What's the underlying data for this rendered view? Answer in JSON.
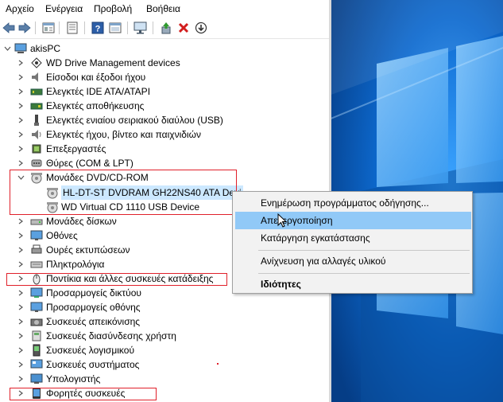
{
  "menu": [
    "Αρχείο",
    "Ενέργεια",
    "Προβολή",
    "Βοήθεια"
  ],
  "tree": {
    "root": "akisPC",
    "categories": [
      "WD Drive Management devices",
      "Είσοδοι και έξοδοι ήχου",
      "Ελεγκτές IDE ATA/ATAPI",
      "Ελεγκτές αποθήκευσης",
      "Ελεγκτές ενιαίου σειριακού διαύλου (USB)",
      "Ελεγκτές ήχου, βίντεο και παιχνιδιών",
      "Επεξεργαστές",
      "Θύρες (COM & LPT)",
      "Μονάδες DVD/CD-ROM",
      "Μονάδες δίσκων",
      "Οθόνες",
      "Ουρές εκτυπώσεων",
      "Πληκτρολόγια",
      "Ποντίκια και άλλες συσκευές κατάδειξης",
      "Προσαρμογείς δικτύου",
      "Προσαρμογείς οθόνης",
      "Συσκευές απεικόνισης",
      "Συσκευές διασύνδεσης χρήστη",
      "Συσκευές λογισμικού",
      "Συσκευές συστήματος",
      "Υπολογιστής",
      "Φορητές συσκευές"
    ],
    "dvd_children": [
      "HL-DT-ST DVDRAM GH22NS40 ATA Devi",
      "WD Virtual CD 1110 USB Device"
    ]
  },
  "context_menu": {
    "update": "Ενημέρωση προγράμματος οδήγησης...",
    "disable": "Απενεργοποίηση",
    "uninstall": "Κατάργηση εγκατάστασης",
    "scan": "Ανίχνευση για αλλαγές υλικού",
    "properties": "Ιδιότητες"
  },
  "colors": {
    "annotation": "#e0202a",
    "highlight": "#91c9f7",
    "selection": "#cce8ff",
    "desktop": "#0a5fb4"
  }
}
